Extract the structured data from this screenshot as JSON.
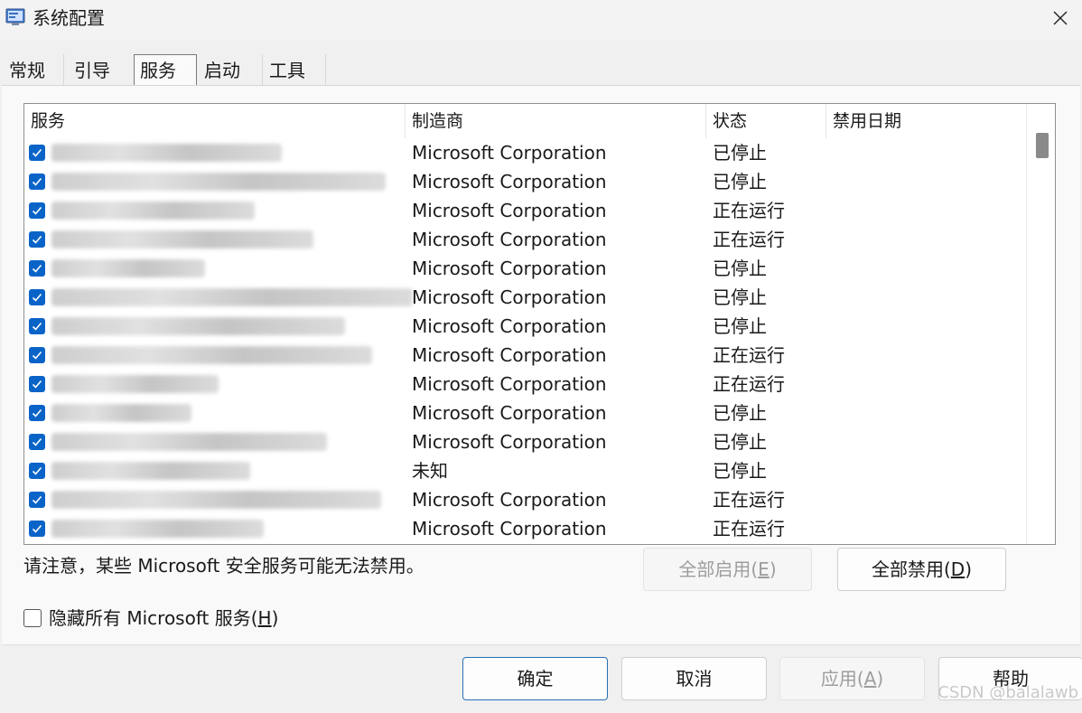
{
  "window": {
    "title": "系统配置",
    "close_glyph": "✕"
  },
  "tabs": [
    {
      "label": "常规",
      "active": false
    },
    {
      "label": "引导",
      "active": false
    },
    {
      "label": "服务",
      "active": true
    },
    {
      "label": "启动",
      "active": false
    },
    {
      "label": "工具",
      "active": false
    }
  ],
  "services_table": {
    "columns": [
      "服务",
      "制造商",
      "状态",
      "禁用日期"
    ],
    "rows": [
      {
        "checked": true,
        "manufacturer": "Microsoft Corporation",
        "status": "已停止"
      },
      {
        "checked": true,
        "manufacturer": "Microsoft Corporation",
        "status": "已停止"
      },
      {
        "checked": true,
        "manufacturer": "Microsoft Corporation",
        "status": "正在运行"
      },
      {
        "checked": true,
        "manufacturer": "Microsoft Corporation",
        "status": "正在运行"
      },
      {
        "checked": true,
        "manufacturer": "Microsoft Corporation",
        "status": "已停止"
      },
      {
        "checked": true,
        "manufacturer": "Microsoft Corporation",
        "status": "已停止"
      },
      {
        "checked": true,
        "manufacturer": "Microsoft Corporation",
        "status": "已停止"
      },
      {
        "checked": true,
        "manufacturer": "Microsoft Corporation",
        "status": "正在运行"
      },
      {
        "checked": true,
        "manufacturer": "Microsoft Corporation",
        "status": "正在运行"
      },
      {
        "checked": true,
        "manufacturer": "Microsoft Corporation",
        "status": "已停止"
      },
      {
        "checked": true,
        "manufacturer": "Microsoft Corporation",
        "status": "已停止"
      },
      {
        "checked": true,
        "manufacturer": "未知",
        "status": "已停止"
      },
      {
        "checked": true,
        "manufacturer": "Microsoft Corporation",
        "status": "正在运行"
      },
      {
        "checked": true,
        "manufacturer": "Microsoft Corporation",
        "status": "正在运行"
      }
    ]
  },
  "notice": "请注意，某些 Microsoft 安全服务可能无法禁用。",
  "buttons": {
    "enable_all": {
      "label": "全部启用",
      "mnemonic": "E",
      "enabled": false
    },
    "disable_all": {
      "label": "全部禁用",
      "mnemonic": "D",
      "enabled": true
    },
    "ok": {
      "label": "确定",
      "enabled": true
    },
    "cancel": {
      "label": "取消",
      "enabled": true
    },
    "apply": {
      "label": "应用",
      "mnemonic": "A",
      "enabled": false
    },
    "help": {
      "label": "帮助",
      "enabled": true
    }
  },
  "hide_ms_services": {
    "label": "隐藏所有 Microsoft 服务",
    "mnemonic": "H",
    "checked": false
  },
  "watermark": "CSDN @balalawb",
  "colors": {
    "accent": "#0a64c8",
    "disabled_text": "#9d9d9d"
  }
}
